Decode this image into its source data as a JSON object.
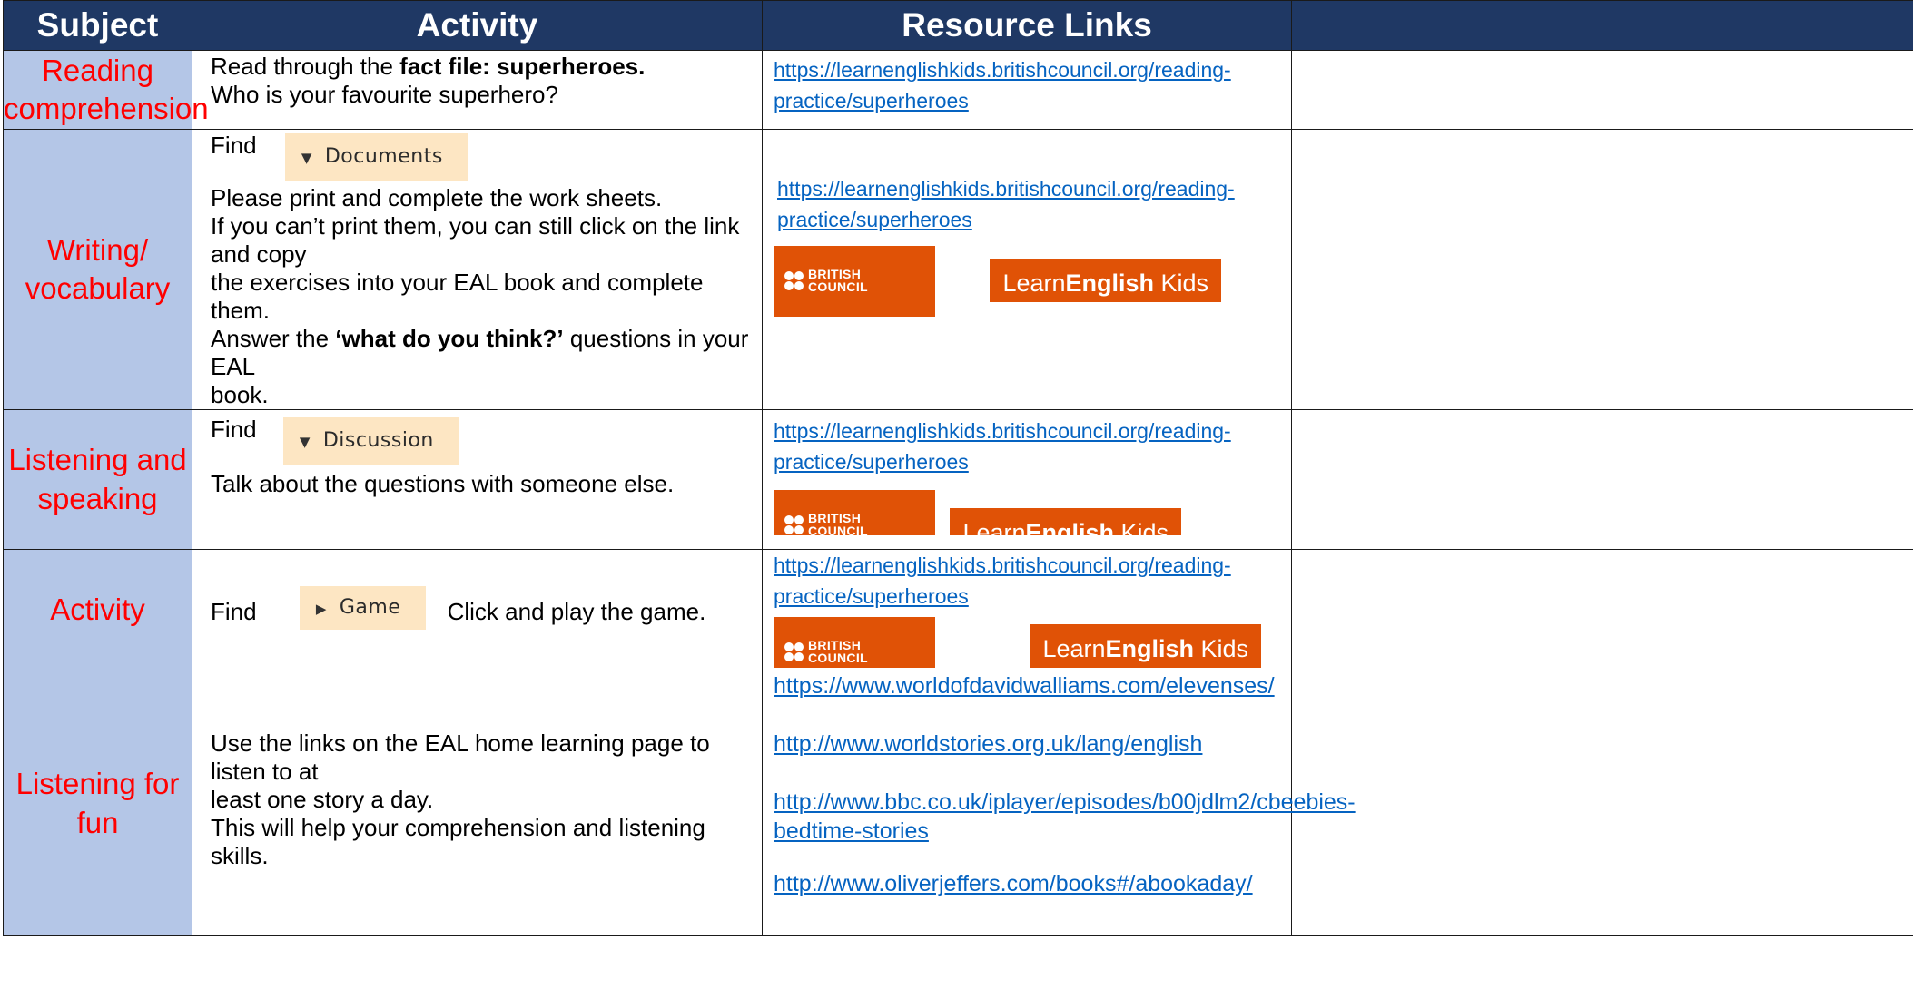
{
  "headers": {
    "subject": "Subject",
    "activity": "Activity",
    "resources": "Resource Links",
    "extra": ""
  },
  "rows": [
    {
      "subject_line1": "Reading",
      "subject_line2": "comprehension",
      "activity": {
        "line1_prefix": "Read through the ",
        "line1_bold": "fact file: superheroes.",
        "line2": "Who is your favourite superhero?"
      },
      "links": [
        {
          "line1": "https://learnenglishkids.britishcouncil.org/reading-",
          "line2": "practice/superheroes"
        }
      ]
    },
    {
      "subject_line1": "Writing/",
      "subject_line2": "vocabulary",
      "activity": {
        "find": "Find",
        "pill": "Documents",
        "line1": "Please print and complete the work sheets.",
        "line2": "If you can’t print them, you can still click on the link and copy",
        "line3": "the exercises into your EAL book and complete them.",
        "line4_prefix": "Answer the ",
        "line4_bold": "‘what do you think?’",
        "line4_suffix": " questions in your EAL",
        "line5": "book."
      },
      "links": [
        {
          "line1": "https://learnenglishkids.britishcouncil.org/reading-",
          "line2": "practice/superheroes"
        }
      ]
    },
    {
      "subject_line1": "Listening and",
      "subject_line2": "speaking",
      "activity": {
        "find": "Find",
        "pill": "Discussion",
        "line1": "Talk about the questions with someone else."
      },
      "links": [
        {
          "line1": "https://learnenglishkids.britishcouncil.org/reading-",
          "line2": "practice/superheroes"
        }
      ]
    },
    {
      "subject_line1": "Activity",
      "activity": {
        "find": "Find",
        "pill": "Game",
        "after": "Click and play the game."
      },
      "links": [
        {
          "line1": "https://learnenglishkids.britishcouncil.org/reading-",
          "line2": "practice/superheroes"
        }
      ]
    },
    {
      "subject_line1": "Listening for",
      "subject_line2": "fun",
      "activity": {
        "line1": "Use the links on the EAL home learning page to listen to at",
        "line2": "least one story a day.",
        "line3": "This will help your comprehension and listening skills."
      },
      "links": [
        {
          "line1": "https://www.worldofdavidwalliams.com/elevenses/"
        },
        {
          "line1": "http://www.worldstories.org.uk/lang/english"
        },
        {
          "line1": "http://www.bbc.co.uk/iplayer/episodes/b00jdlm2/cbeebies-",
          "line2": "bedtime-stories"
        },
        {
          "line1": "http://www.oliverjeffers.com/books#/abookaday/"
        }
      ]
    }
  ],
  "logos": {
    "british_council_line1": "BRITISH",
    "british_council_line2": "COUNCIL",
    "learn_english_prefix": "Learn",
    "learn_english_bold": "English",
    "learn_english_suffix": " Kids",
    "brand_color": "#e05206"
  },
  "colors": {
    "header_bg": "#1f3864",
    "subject_bg": "#b4c6e7",
    "subject_text": "#ff0000",
    "link": "#0563c1",
    "pill_bg": "#fde6c3"
  },
  "icons": {
    "collapsed_section": "triangle-down-icon",
    "expandable_section": "triangle-right-icon"
  }
}
